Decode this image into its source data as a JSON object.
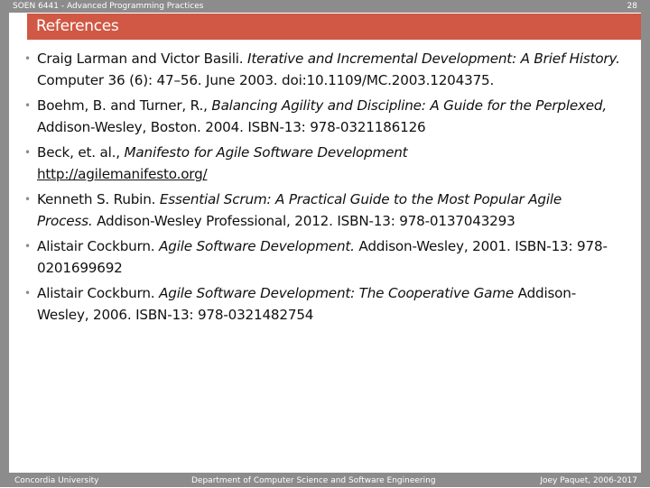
{
  "header": {
    "course": "SOEN 6441 - Advanced Programming Practices",
    "page_number": "28"
  },
  "title": "References",
  "references": [
    {
      "pre": "Craig Larman and Victor Basili. ",
      "italic": "Iterative and Incremental Development: A Brief History.",
      "post": " Computer 36 (6): 47–56. June 2003. doi:10.1109/MC.2003.1204375.",
      "link": ""
    },
    {
      "pre": "Boehm, B. and Turner, R., ",
      "italic": "Balancing Agility and Discipline: A Guide for the Perplexed,",
      "post": " Addison-Wesley, Boston. 2004. ISBN-13: 978-0321186126",
      "link": ""
    },
    {
      "pre": "Beck, et. al., ",
      "italic": "Manifesto for Agile Software Development",
      "post": "",
      "link": "http://agilemanifesto.org/"
    },
    {
      "pre": "Kenneth S. Rubin. ",
      "italic": "Essential Scrum: A Practical Guide to the Most Popular Agile Process.",
      "post": " Addison-Wesley Professional, 2012. ISBN-13: 978-0137043293",
      "link": ""
    },
    {
      "pre": "Alistair Cockburn. ",
      "italic": "Agile Software Development.",
      "post": " Addison-Wesley, 2001. ISBN-13: 978-0201699692",
      "link": ""
    },
    {
      "pre": "Alistair Cockburn. ",
      "italic": "Agile Software Development: The Cooperative Game",
      "post": " Addison-Wesley, 2006. ISBN-13: 978-0321482754",
      "link": ""
    }
  ],
  "footer": {
    "left": "Concordia University",
    "center": "Department of Computer Science and Software Engineering",
    "right": "Joey Paquet, 2006-2017"
  },
  "colors": {
    "gray_bar": "#8c8c8c",
    "title_bar": "#d05844",
    "text": "#111111"
  }
}
